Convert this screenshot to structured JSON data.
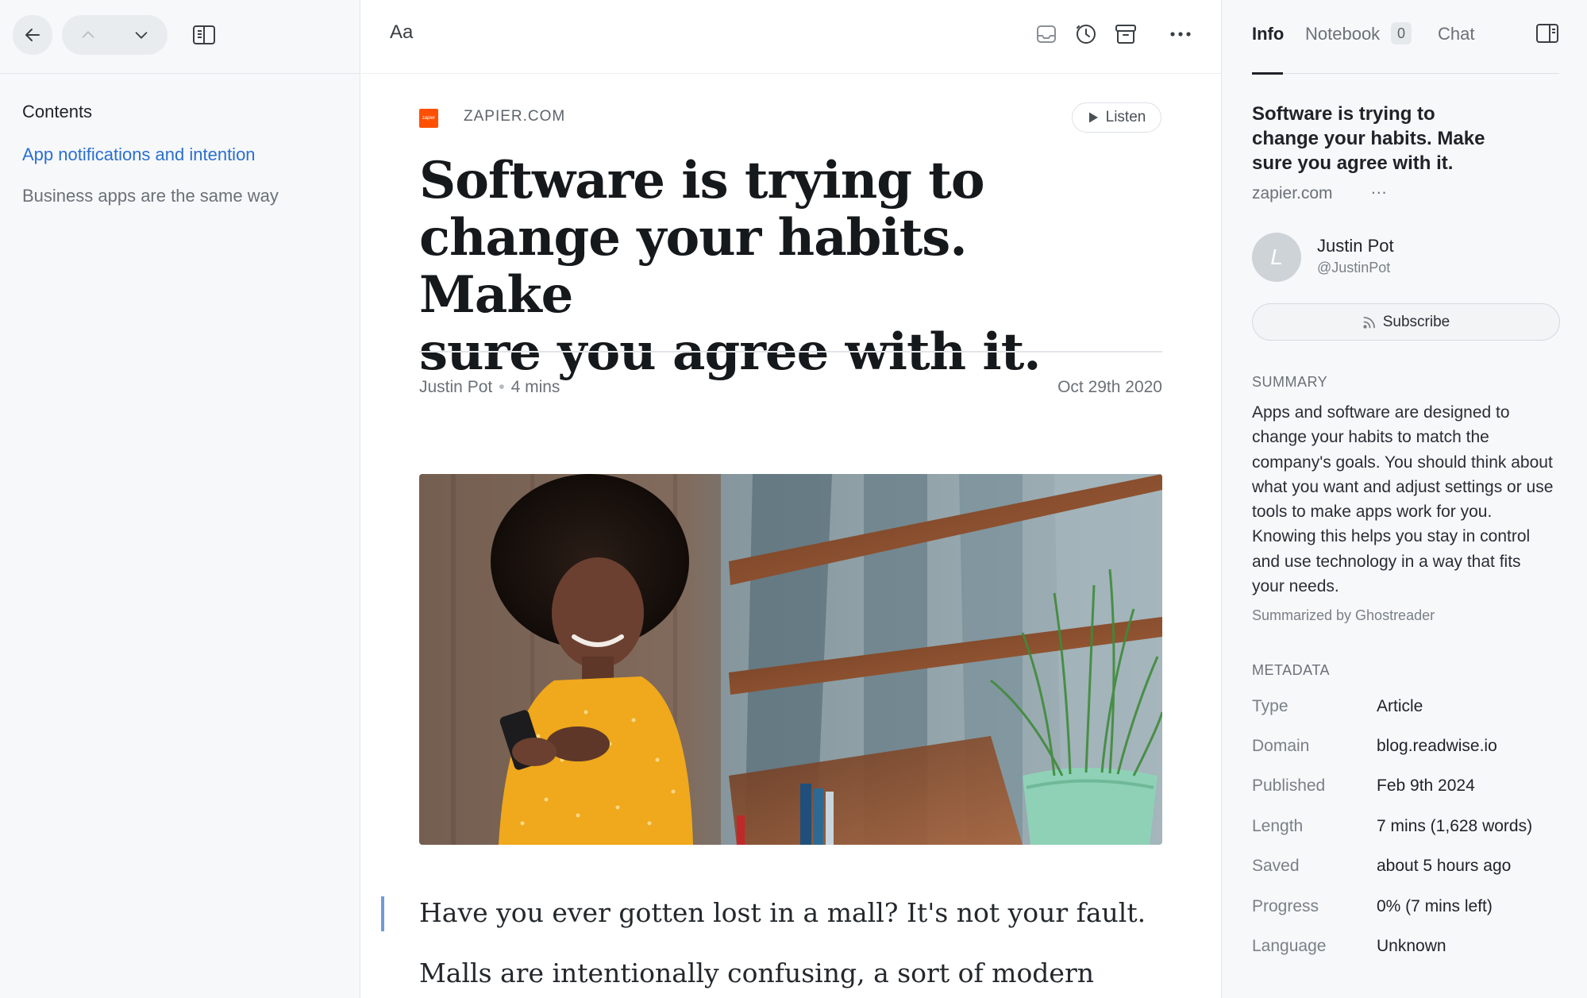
{
  "left_sidebar": {
    "contents_title": "Contents",
    "toc": [
      {
        "label": "App notifications and intention",
        "active": true
      },
      {
        "label": "Business apps are the same way",
        "active": false
      }
    ]
  },
  "toolbar": {
    "font_button": "Aa"
  },
  "article": {
    "source": "ZAPIER.COM",
    "source_logo_text": "zapier",
    "listen_label": "Listen",
    "title_lines": [
      "Software is trying to",
      "change your habits. Make",
      "sure you agree with it."
    ],
    "author": "Justin Pot",
    "read_time": "4 mins",
    "date": "Oct 29th 2020",
    "paragraphs": [
      "Have you ever gotten lost in a mall? It's not your fault.",
      "Malls are intentionally confusing, a sort of modern"
    ]
  },
  "right_panel": {
    "tabs": {
      "info": "Info",
      "notebook": "Notebook",
      "notebook_count": "0",
      "chat": "Chat"
    },
    "title_lines": [
      "Software is trying to",
      "change your habits. Make",
      "sure you agree with it."
    ],
    "domain": "zapier.com",
    "more": "...",
    "author": {
      "name": "Justin Pot",
      "handle": "@JustinPot",
      "avatar_letter": "L"
    },
    "subscribe_label": "Subscribe",
    "summary_heading": "SUMMARY",
    "summary_text": "Apps and software are designed to change your habits to match the company's goals. You should think about what you want and adjust settings or use tools to make apps work for you. Knowing this helps you stay in control and use technology in a way that fits your needs.",
    "summary_credit": "Summarized by Ghostreader",
    "metadata_heading": "METADATA",
    "metadata": [
      {
        "label": "Type",
        "value": "Article"
      },
      {
        "label": "Domain",
        "value": "blog.readwise.io"
      },
      {
        "label": "Published",
        "value": "Feb 9th 2024"
      },
      {
        "label": "Length",
        "value": "7 mins (1,628 words)"
      },
      {
        "label": "Saved",
        "value": "about 5 hours ago"
      },
      {
        "label": "Progress",
        "value": "0% (7 mins left)"
      },
      {
        "label": "Language",
        "value": "Unknown"
      }
    ]
  },
  "colors": {
    "accent_link": "#2b6fcf",
    "zapier_orange": "#ff4f00",
    "panel_bg": "#f6f8fa"
  },
  "icons": [
    "back-arrow-icon",
    "chevron-up-icon",
    "chevron-down-icon",
    "sidebar-toggle-icon",
    "inbox-icon",
    "clock-icon",
    "archive-icon",
    "more-horizontal-icon",
    "play-icon",
    "rss-icon",
    "panel-toggle-icon"
  ]
}
